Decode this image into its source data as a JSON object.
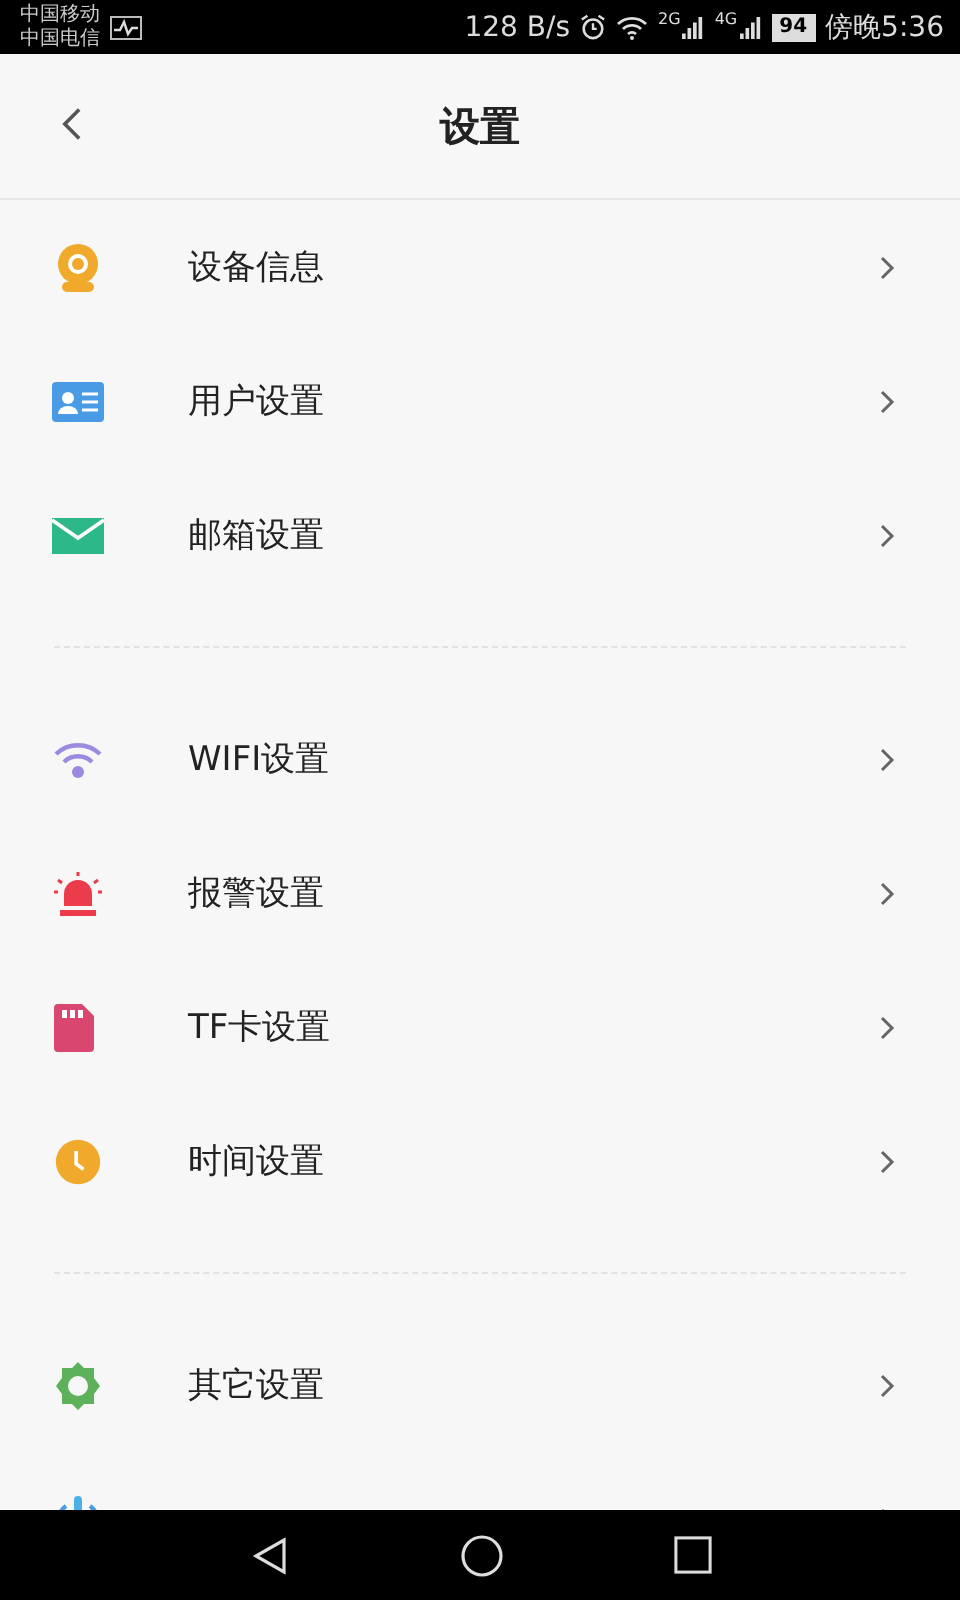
{
  "status_bar": {
    "carriers": [
      "中国移动",
      "中国电信"
    ],
    "speed": "128 B/s",
    "networks": [
      "2G",
      "4G"
    ],
    "battery": "94",
    "time": "傍晚5:36"
  },
  "header": {
    "title": "设置"
  },
  "groups": [
    {
      "items": [
        {
          "kind": "row",
          "label": "设备信息"
        },
        {
          "kind": "row",
          "label": "用户设置"
        },
        {
          "kind": "row",
          "label": "邮箱设置"
        }
      ]
    },
    {
      "items": [
        {
          "kind": "row",
          "label": "WIFI设置"
        },
        {
          "kind": "row",
          "label": "报警设置"
        },
        {
          "kind": "row",
          "label": "TF卡设置"
        },
        {
          "kind": "row",
          "label": "时间设置"
        }
      ]
    },
    {
      "items": [
        {
          "kind": "row",
          "label": "其它设置"
        },
        {
          "kind": "clipped"
        }
      ]
    }
  ]
}
